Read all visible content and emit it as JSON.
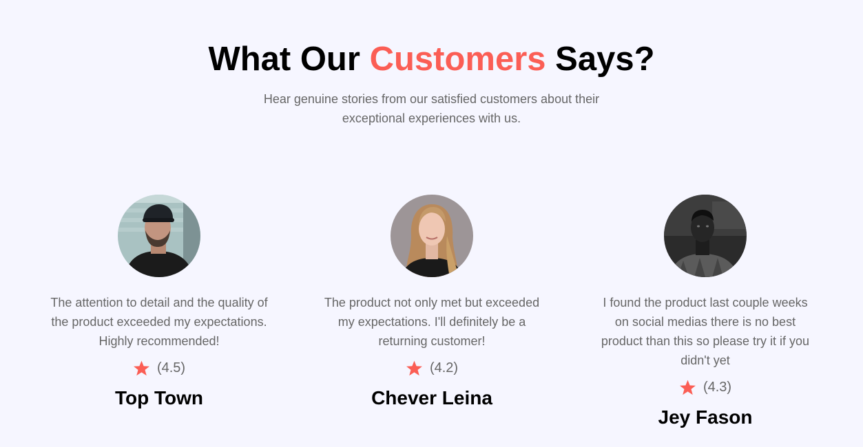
{
  "section": {
    "heading_pre": "What Our",
    "heading_accent": "Customers",
    "heading_post": "Says?",
    "subtitle": "Hear genuine stories from our satisfied customers about their exceptional experiences with us.",
    "accent_color": "#fb5e55"
  },
  "testimonials": [
    {
      "quote": "The attention to detail and the quality of the product exceeded my expectations. Highly recommended!",
      "rating_text": "(4.5)",
      "rating": 4.5,
      "name": "Top Town",
      "avatar_icon": "avatar-man-cap"
    },
    {
      "quote": "The product not only met but exceeded my expectations. I'll definitely be a returning customer!",
      "rating_text": "(4.2)",
      "rating": 4.2,
      "name": "Chever Leina",
      "avatar_icon": "avatar-woman-blonde"
    },
    {
      "quote": "I found the product last couple weeks on social medias there is no best product than this so please try it if you didn't yet",
      "rating_text": "(4.3)",
      "rating": 4.3,
      "name": "Jey Fason",
      "avatar_icon": "avatar-man-grayscale"
    }
  ]
}
